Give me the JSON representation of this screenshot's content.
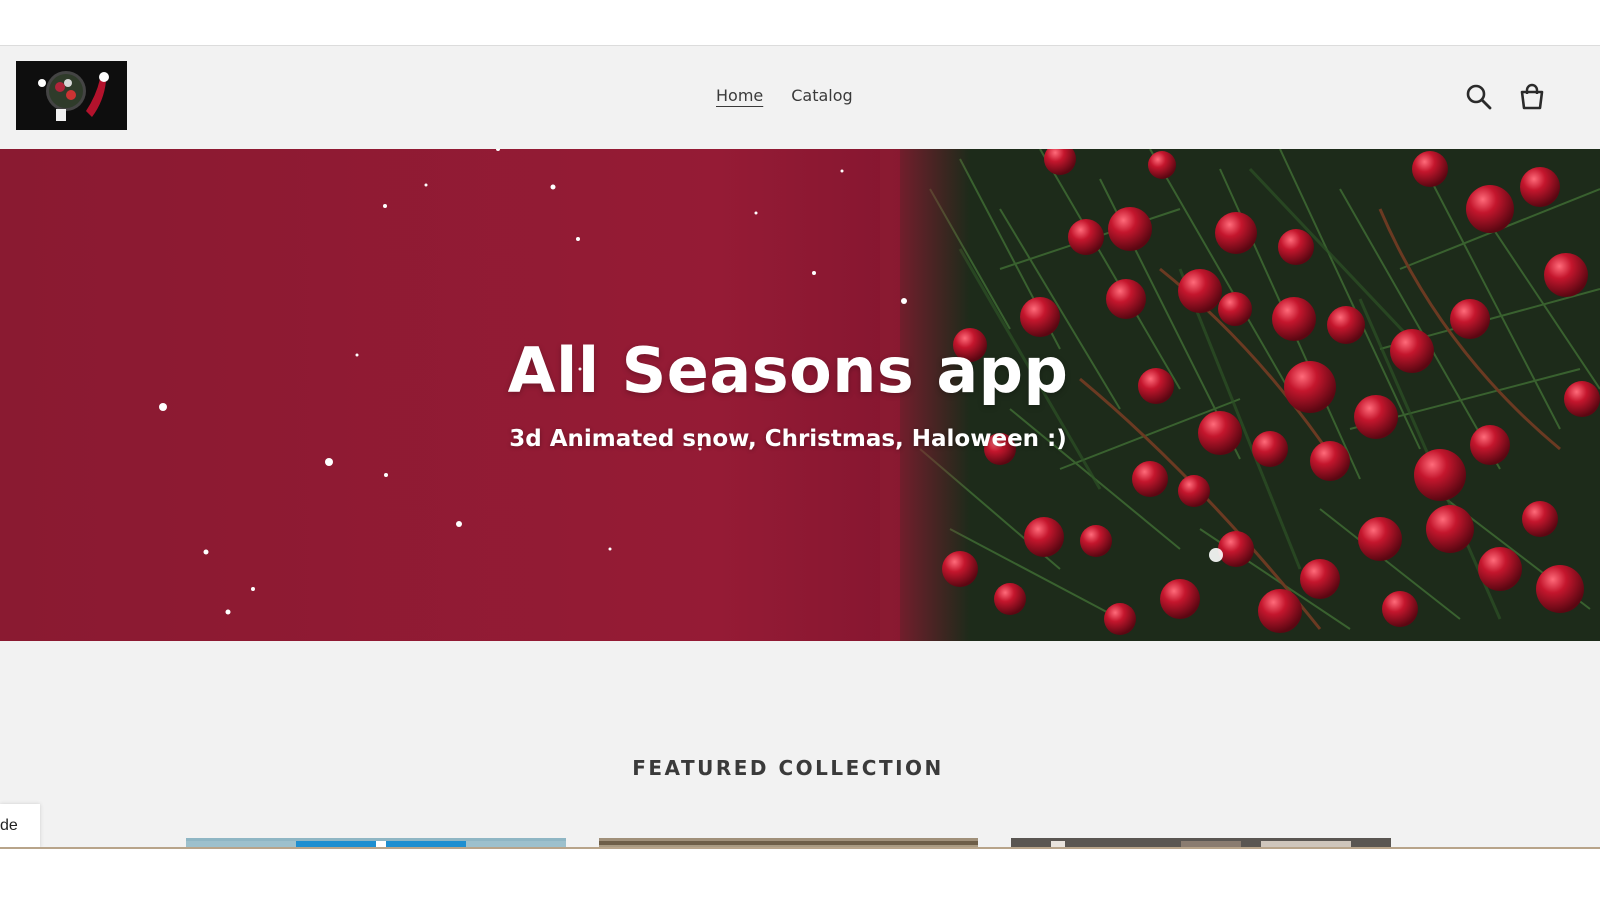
{
  "header": {
    "nav": [
      {
        "label": "Home",
        "active": true
      },
      {
        "label": "Catalog",
        "active": false
      }
    ],
    "icons": [
      "search-icon",
      "cart-icon"
    ]
  },
  "hero": {
    "title": "All Seasons app",
    "subtitle": "3d Animated snow, Christmas, Haloween :)"
  },
  "featured": {
    "heading": "FEATURED COLLECTION"
  },
  "side_tab": {
    "label": "de"
  },
  "colors": {
    "hero_red": "#951b35",
    "header_bg": "#f2f2f2",
    "text": "#3a3a3a"
  }
}
